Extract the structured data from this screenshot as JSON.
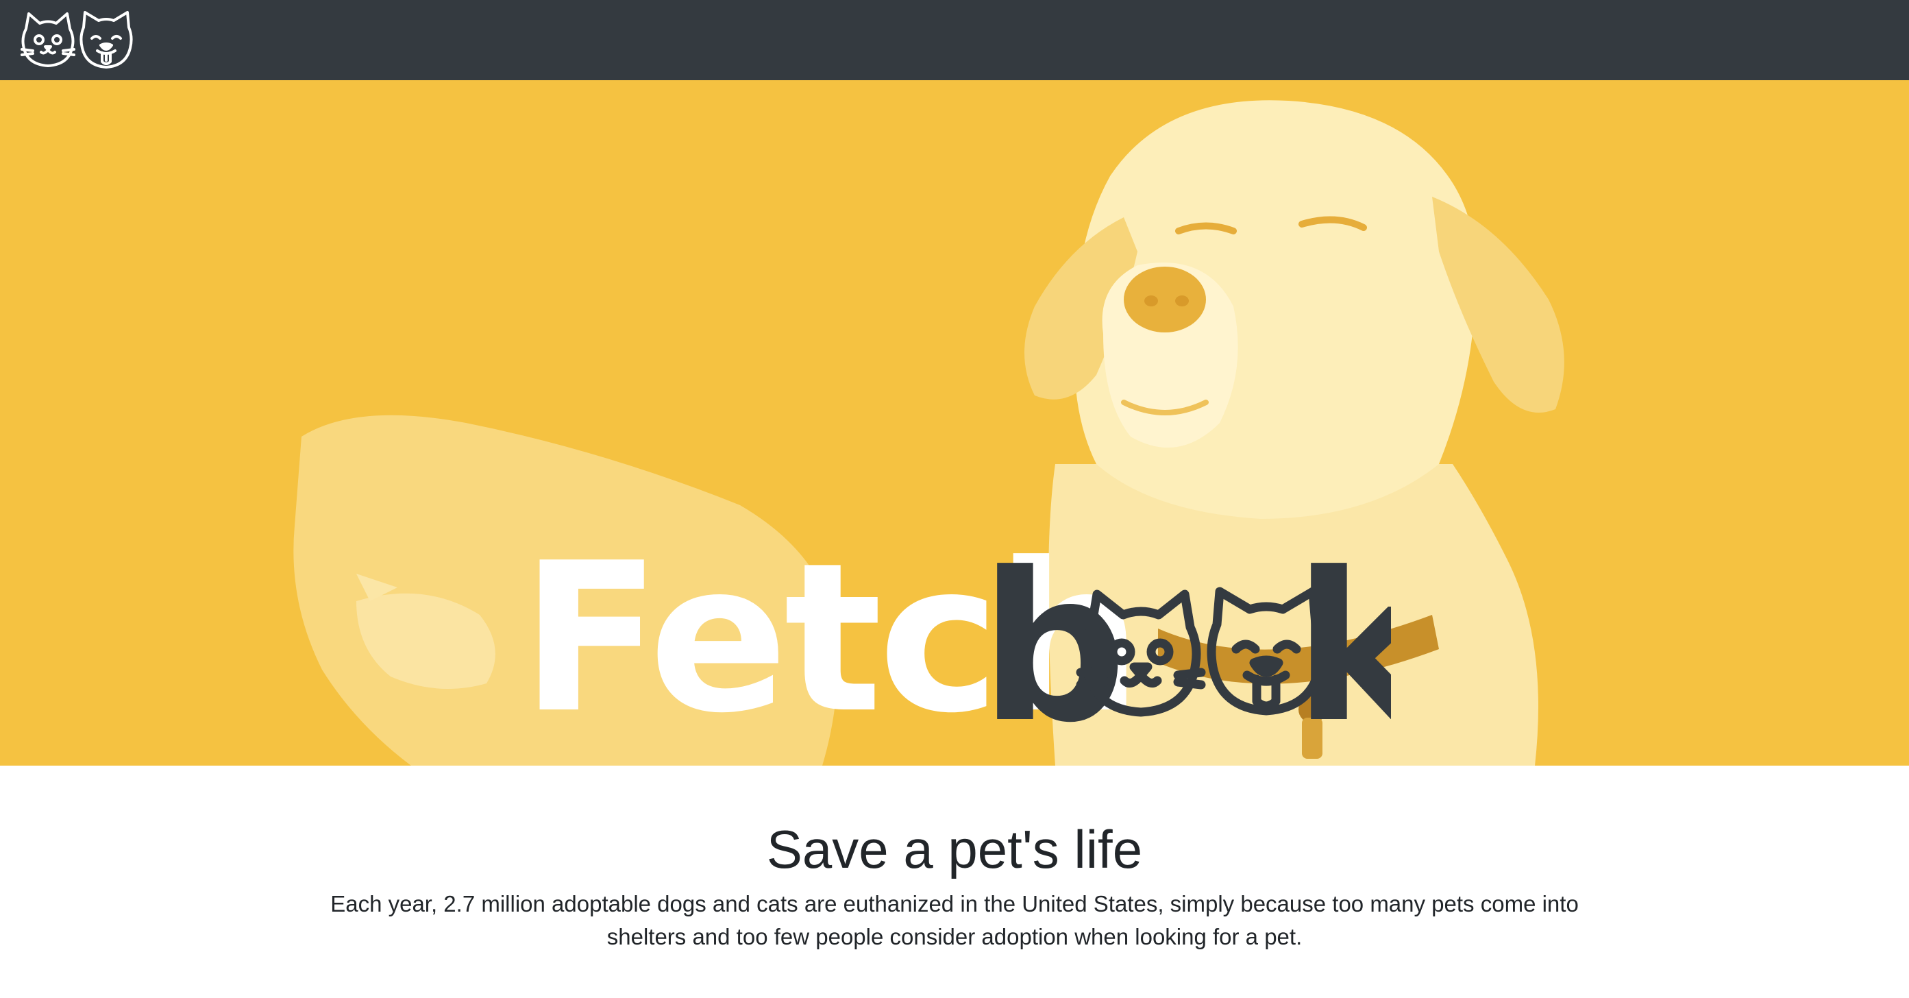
{
  "brand": {
    "wordmark_light": "Fetch",
    "wordmark_dark": "b",
    "wordmark_end": "k",
    "nav_logo_icons": [
      "cat-face-icon",
      "dog-face-icon"
    ],
    "wordmark_icons": [
      "cat-face-icon",
      "dog-face-icon"
    ]
  },
  "hero": {
    "background": "#f5c241",
    "photo_subjects": [
      "dog",
      "cat"
    ]
  },
  "content": {
    "headline": "Save a pet's life",
    "lead": "Each year, 2.7 million adoptable dogs and cats are euthanized in the United States, simply because too many pets come into shelters and too few people consider adoption when looking for a pet."
  },
  "colors": {
    "navbar": "#343a40",
    "hero_yellow": "#f5c241",
    "wordmark_dark": "#343a40",
    "text": "#212529"
  }
}
